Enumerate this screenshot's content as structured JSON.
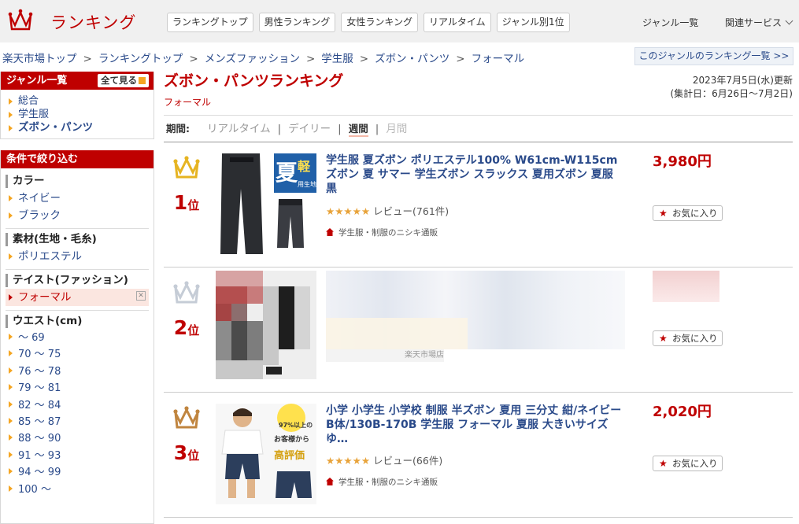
{
  "header": {
    "logo_text": "ランキング",
    "nav": [
      "ランキングトップ",
      "男性ランキング",
      "女性ランキング",
      "リアルタイム",
      "ジャンル別1位"
    ],
    "genre_list": "ジャンル一覧",
    "related": "関連サービス"
  },
  "breadcrumb": [
    "楽天市場トップ",
    "ランキングトップ",
    "メンズファッション",
    "学生服",
    "ズボン・パンツ",
    "フォーマル"
  ],
  "genre_ranking_link": "このジャンルのランキング一覧 >>",
  "sidebar": {
    "genre_head": "ジャンル一覧",
    "all_btn": "全て見る",
    "genres": [
      "総合",
      "学生服",
      "ズボン・パンツ"
    ],
    "filter_head": "条件で絞り込む",
    "color_title": "カラー",
    "colors": [
      "ネイビー",
      "ブラック"
    ],
    "material_title": "素材(生地・毛糸)",
    "materials": [
      "ポリエステル"
    ],
    "taste_title": "テイスト(ファッション)",
    "taste_selected": "フォーマル",
    "waist_title": "ウエスト(cm)",
    "waists": [
      "～ 69",
      "70 ～ 75",
      "76 ～ 78",
      "79 ～ 81",
      "82 ～ 84",
      "85 ～ 87",
      "88 ～ 90",
      "91 ～ 93",
      "94 ～ 99",
      "100 ～"
    ]
  },
  "main": {
    "title": "ズボン・パンツランキング",
    "sub": "フォーマル",
    "updated": "2023年7月5日(水)更新",
    "period_range": "(集計日：6月26日～7月2日)",
    "period_label": "期間:",
    "periods": [
      "リアルタイム",
      "デイリー",
      "週間",
      "月間"
    ]
  },
  "items": [
    {
      "rank": "1",
      "rank_suffix": "位",
      "title": "学生服 夏ズボン ポリエステル100% W61cm-W115cm ズボン 夏 サマー 学生ズボン スラックス 夏用ズボン 夏服 黒",
      "stars": "★★★★★",
      "reviews": "レビュー(761件)",
      "shop": "学生服・制服のニシキ通販",
      "price": "3,980円",
      "fav": "お気に入り",
      "crown": "#e6b422"
    },
    {
      "rank": "2",
      "rank_suffix": "位",
      "fav": "お気に入り",
      "blur_text": "楽天市場店",
      "crown": "#c5ccd6"
    },
    {
      "rank": "3",
      "rank_suffix": "位",
      "title": "小学 小学生 小学校 制服 半ズボン 夏用 三分丈 紺/ネイビー B体/130B-170B 学生服 フォーマル 夏服 大きいサイズ ゆ…",
      "stars": "★★★★★",
      "reviews": "レビュー(66件)",
      "shop": "学生服・制服のニシキ通販",
      "price": "2,020円",
      "fav": "お気に入り",
      "crown": "#c0853f"
    }
  ],
  "thumb_text": {
    "summer": "夏",
    "light": "軽",
    "fabric": "用生地",
    "rating": "97%以上の",
    "customer": "お客様から",
    "high": "高評価"
  }
}
